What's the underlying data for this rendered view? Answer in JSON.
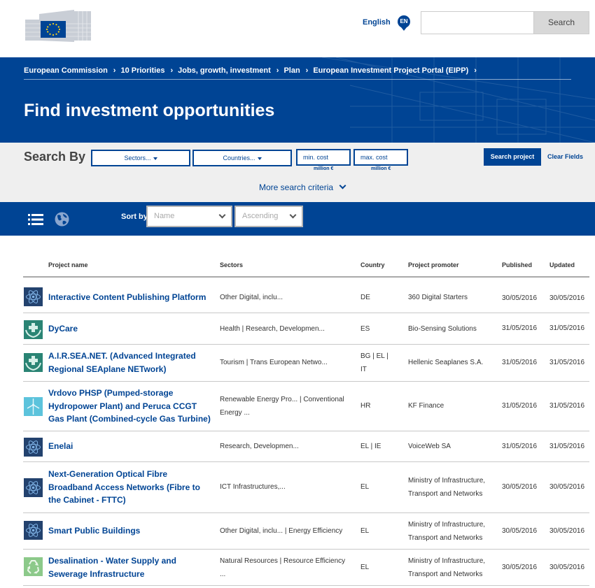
{
  "header": {
    "language": "English",
    "language_code": "EN",
    "search_placeholder": "",
    "search_button": "Search"
  },
  "breadcrumb": [
    "European Commission",
    "10 Priorities",
    "Jobs, growth, investment",
    "Plan",
    "European Investment Project Portal (EIPP)"
  ],
  "banner": {
    "title": "Find investment opportunities"
  },
  "search_by": {
    "label": "Search By",
    "sectors": "Sectors...",
    "countries": "Countries...",
    "min_cost": "min. cost",
    "max_cost": "max. cost",
    "cost_unit": "million €",
    "search_button": "Search project",
    "clear_button": "Clear Fields",
    "more_criteria": "More search criteria"
  },
  "sort": {
    "label": "Sort by",
    "field": "Name",
    "order": "Ascending"
  },
  "table": {
    "headers": {
      "name": "Project name",
      "sectors": "Sectors",
      "country": "Country",
      "promoter": "Project promoter",
      "published": "Published",
      "updated": "Updated"
    },
    "rows": [
      {
        "name": "Interactive Content Publishing Platform",
        "sectors": "Other Digital, inclu...",
        "country": "DE",
        "promoter": "360 Digital Starters",
        "published": "30/05/2016",
        "updated": "30/05/2016",
        "icon": "atom-icon"
      },
      {
        "name": "DyCare",
        "sectors": "Health | Research, Developmen...",
        "country": "ES",
        "promoter": "Bio-Sensing Solutions",
        "published": "31/05/2016",
        "updated": "31/05/2016",
        "icon": "health-icon"
      },
      {
        "name": "A.I.R.SEA.NET. (Advanced Integrated Regional SEAplane NETwork)",
        "sectors": "Tourism | Trans European Netwo...",
        "country": "BG | EL | IT",
        "promoter": "Hellenic Seaplanes S.A.",
        "published": "31/05/2016",
        "updated": "31/05/2016",
        "icon": "health-icon"
      },
      {
        "name": "Vrdovo PHSP (Pumped-storage Hydropower Plant) and Peruca CCGT Gas Plant (Combined-cycle Gas Turbine)",
        "sectors": "Renewable Energy Pro... | Conventional Energy ...",
        "country": "HR",
        "promoter": "KF Finance",
        "published": "31/05/2016",
        "updated": "31/05/2016",
        "icon": "wind-turbine-icon"
      },
      {
        "name": "Enelai",
        "sectors": "Research, Developmen...",
        "country": "EL | IE",
        "promoter": "VoiceWeb SA",
        "published": "31/05/2016",
        "updated": "31/05/2016",
        "icon": "atom-icon"
      },
      {
        "name": "Next-Generation Optical Fibre Broadband Access Networks (Fibre to the Cabinet - FTTC)",
        "sectors": "ICT Infrastructures,...",
        "country": "EL",
        "promoter": "Ministry of Infrastructure, Transport and Networks",
        "published": "30/05/2016",
        "updated": "30/05/2016",
        "icon": "atom-icon"
      },
      {
        "name": "Smart Public Buildings",
        "sectors": "Other Digital, inclu... | Energy Efficiency",
        "country": "EL",
        "promoter": "Ministry of Infrastructure, Transport and Networks",
        "published": "30/05/2016",
        "updated": "30/05/2016",
        "icon": "atom-icon"
      },
      {
        "name": "Desalination - Water Supply and Sewerage Infrastructure",
        "sectors": "Natural Resources | Resource Efficiency ...",
        "country": "EL",
        "promoter": "Ministry of Infrastructure, Transport and Networks",
        "published": "30/05/2016",
        "updated": "30/05/2016",
        "icon": "recycle-icon"
      }
    ]
  },
  "colors": {
    "brand_blue": "#004494",
    "icon_navy": "#23426e",
    "icon_teal": "#2a8474",
    "icon_cyan": "#5cc3dc",
    "icon_green": "#8cc98a"
  }
}
